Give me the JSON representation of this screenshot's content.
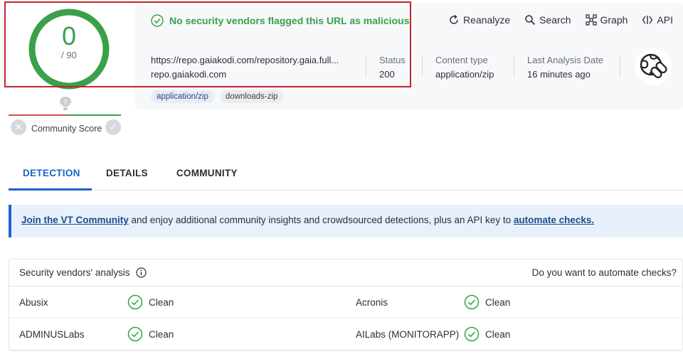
{
  "score": {
    "detections": "0",
    "total": "/ 90"
  },
  "community": {
    "label": "Community Score",
    "question_icon": "question-icon"
  },
  "status_message": "No security vendors flagged this URL as malicious",
  "toolbar": [
    {
      "label": "Reanalyze",
      "icon": "refresh-icon"
    },
    {
      "label": "Search",
      "icon": "search-icon"
    },
    {
      "label": "Graph",
      "icon": "graph-icon"
    },
    {
      "label": "API",
      "icon": "api-icon"
    }
  ],
  "url": {
    "full": "https://repo.gaiakodi.com/repository.gaia.full...",
    "domain": "repo.gaiakodi.com"
  },
  "meta": {
    "status": {
      "label": "Status",
      "value": "200"
    },
    "content_type": {
      "label": "Content type",
      "value": "application/zip"
    },
    "last_analysis": {
      "label": "Last Analysis Date",
      "value": "16 minutes ago"
    }
  },
  "tags": [
    "application/zip",
    "downloads-zip"
  ],
  "tabs": [
    "DETECTION",
    "DETAILS",
    "COMMUNITY"
  ],
  "banner": {
    "link1": "Join the VT Community",
    "text": " and enjoy additional community insights and crowdsourced detections, plus an API key to ",
    "link2": "automate checks."
  },
  "vendors": {
    "title": "Security vendors' analysis",
    "cta": "Do you want to automate checks?",
    "rows": [
      [
        {
          "name": "Abusix",
          "result": "Clean"
        },
        {
          "name": "Acronis",
          "result": "Clean"
        }
      ],
      [
        {
          "name": "ADMINUSLabs",
          "result": "Clean"
        },
        {
          "name": "AILabs (MONITORAPP)",
          "result": "Clean"
        }
      ]
    ]
  },
  "colors": {
    "accent": "#1a64c8",
    "clean": "#3aa04a",
    "alert": "#c0272d"
  }
}
